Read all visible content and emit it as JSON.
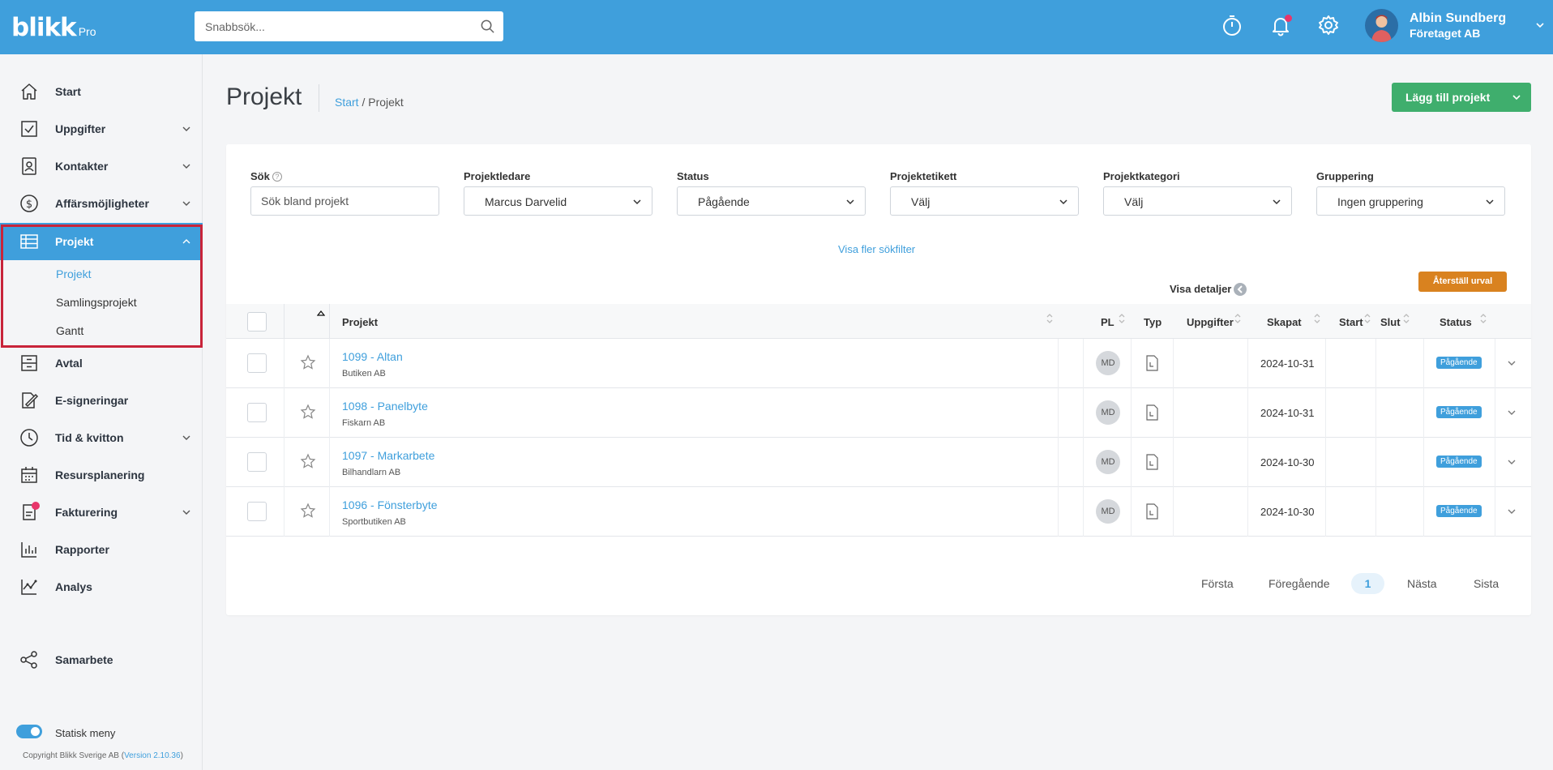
{
  "brand": {
    "name": "blikk",
    "edition": "Pro"
  },
  "topbar": {
    "search_placeholder": "Snabbsök...",
    "user": {
      "name": "Albin Sundberg",
      "company": "Företaget AB"
    }
  },
  "sidebar": {
    "items": [
      {
        "label": "Start"
      },
      {
        "label": "Uppgifter"
      },
      {
        "label": "Kontakter"
      },
      {
        "label": "Affärsmöjligheter"
      },
      {
        "label": "Projekt"
      },
      {
        "label": "Avtal"
      },
      {
        "label": "E-signeringar"
      },
      {
        "label": "Tid & kvitton"
      },
      {
        "label": "Resursplanering"
      },
      {
        "label": "Fakturering"
      },
      {
        "label": "Rapporter"
      },
      {
        "label": "Analys"
      },
      {
        "label": "Samarbete"
      }
    ],
    "submenu": [
      {
        "label": "Projekt"
      },
      {
        "label": "Samlingsprojekt"
      },
      {
        "label": "Gantt"
      }
    ],
    "static_menu_label": "Statisk meny",
    "copyright": "Copyright Blikk Sverige AB (",
    "version": "Version 2.10.36",
    "copyright_end": ")"
  },
  "page": {
    "title": "Projekt",
    "breadcrumb": {
      "home": "Start",
      "separator": " / ",
      "current": "Projekt"
    },
    "add_button": "Lägg till projekt"
  },
  "filters": {
    "search": {
      "label": "Sök",
      "help": "?",
      "placeholder": "Sök bland projekt"
    },
    "manager": {
      "label": "Projektledare",
      "value": "Marcus Darvelid"
    },
    "status": {
      "label": "Status",
      "value": "Pågående"
    },
    "tag": {
      "label": "Projektetikett",
      "value": "Välj"
    },
    "category": {
      "label": "Projektkategori",
      "value": "Välj"
    },
    "grouping": {
      "label": "Gruppering",
      "value": "Ingen gruppering"
    },
    "more": "Visa fler sökfilter",
    "reset": "Återställ urval",
    "details": "Visa detaljer"
  },
  "table": {
    "columns": {
      "project": "Projekt",
      "pl": "PL",
      "type": "Typ",
      "tasks": "Uppgifter",
      "created": "Skapat",
      "start": "Start",
      "end": "Slut",
      "status": "Status"
    },
    "rows": [
      {
        "title": "1099 - Altan",
        "client": "Butiken AB",
        "pl": "MD",
        "created": "2024-10-31",
        "status": "Pågående"
      },
      {
        "title": "1098 - Panelbyte",
        "client": "Fiskarn AB",
        "pl": "MD",
        "created": "2024-10-31",
        "status": "Pågående"
      },
      {
        "title": "1097 - Markarbete",
        "client": "Bilhandlarn AB",
        "pl": "MD",
        "created": "2024-10-30",
        "status": "Pågående"
      },
      {
        "title": "1096 - Fönsterbyte",
        "client": "Sportbutiken AB",
        "pl": "MD",
        "created": "2024-10-30",
        "status": "Pågående"
      }
    ]
  },
  "pagination": {
    "first": "Första",
    "prev": "Föregående",
    "current": "1",
    "next": "Nästa",
    "last": "Sista"
  },
  "colors": {
    "primary": "#3f9fdc",
    "success": "#3fae6d",
    "warning": "#d9821f",
    "highlight": "#c8243a",
    "notification": "#e8366b"
  },
  "icons": {
    "topbar": [
      "search-icon",
      "timer-icon",
      "bell-icon",
      "gear-icon",
      "chevron-down-icon"
    ],
    "sidebar": [
      "home-icon",
      "checkbox-icon",
      "contact-icon",
      "dollar-icon",
      "table-icon",
      "archive-icon",
      "signature-icon",
      "clock-icon",
      "calendar-icon",
      "invoice-icon",
      "bar-chart-icon",
      "line-chart-icon",
      "share-icon"
    ]
  }
}
